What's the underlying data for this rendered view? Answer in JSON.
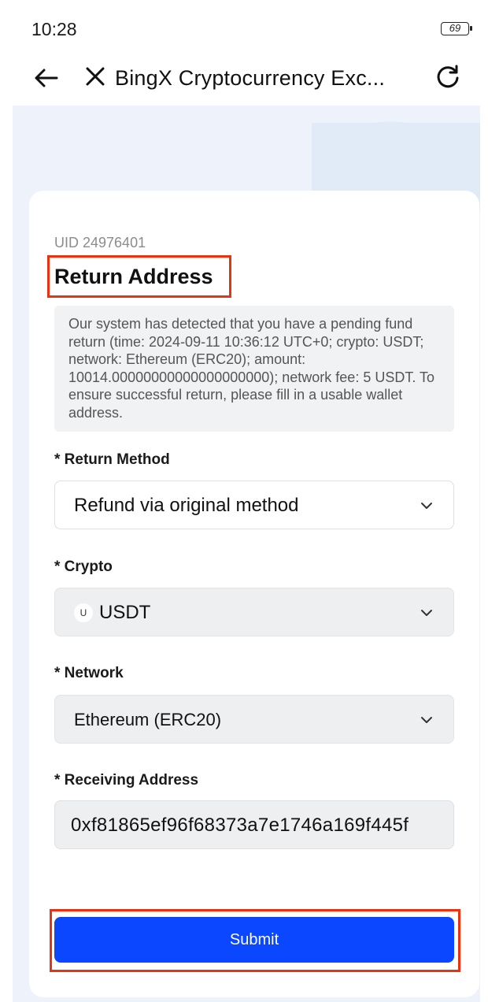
{
  "status_bar": {
    "time": "10:28",
    "battery": "69"
  },
  "nav": {
    "title": "BingX Cryptocurrency Exc..."
  },
  "form": {
    "uid": "UID 24976401",
    "title": "Return Address",
    "notice": "Our system has detected that you have a pending fund return (time: 2024-09-11 10:36:12 UTC+0; crypto: USDT; network: Ethereum (ERC20); amount: 10014.00000000000000000000); network fee: 5 USDT. To ensure successful return, please fill in a usable wallet address.",
    "return_method": {
      "label": "* Return Method",
      "value": "Refund via original method"
    },
    "crypto": {
      "label": "* Crypto",
      "coin_letter": "U",
      "value": "USDT"
    },
    "network": {
      "label": "* Network",
      "value": "Ethereum (ERC20)"
    },
    "receiving_address": {
      "label": "* Receiving Address",
      "value": "0xf81865ef96f68373a7e1746a169f445f"
    },
    "submit_label": "Submit"
  },
  "colors": {
    "primary": "#0a47ff",
    "highlight_border": "#e63312",
    "background": "#eef3fb"
  },
  "icons": [
    "back-arrow-icon",
    "close-icon",
    "refresh-icon",
    "chevron-down-icon",
    "usdt-coin-icon"
  ]
}
